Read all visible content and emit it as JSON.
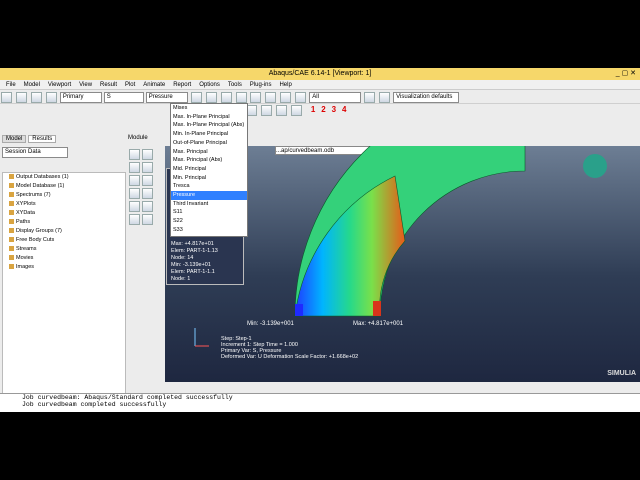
{
  "window": {
    "title": "Abaqus/CAE 6.14-1 [Viewport: 1]"
  },
  "menu": [
    "File",
    "Model",
    "Viewport",
    "View",
    "Result",
    "Plot",
    "Animate",
    "Report",
    "Options",
    "Tools",
    "Plug-ins",
    "Help"
  ],
  "toolbar": {
    "step_select": "Primary",
    "var_select": "S",
    "comp_select": "Pressure",
    "all_select": "All",
    "vis_defaults": "Visualization defaults",
    "frame_nums": [
      "1",
      "2",
      "3",
      "4"
    ]
  },
  "tabs": {
    "model": "Model",
    "results": "Results",
    "module": "Module",
    "visualize": "Visualiz"
  },
  "session_label": "Session Data",
  "tree": [
    "Output Databases (1)",
    "Model Database (1)",
    "Spectrums (7)",
    "XYPlots",
    "XYData",
    "Paths",
    "Display Groups (7)",
    "Free Body Cuts",
    "Streams",
    "Movies",
    "Images"
  ],
  "odb_path": "...ap/curvedbeam.odb",
  "dropdown": {
    "items": [
      "Mises",
      "Max. In-Plane Principal",
      "Max. In-Plane Principal (Abs)",
      "Min. In-Plane Principal",
      "Out-of-Plane Principal",
      "Max. Principal",
      "Max. Principal (Abs)",
      "Mid. Principal",
      "Min. Principal",
      "Tresca",
      "Pressure",
      "Third Invariant",
      "S11",
      "S22",
      "S33"
    ],
    "selected": "Pressure"
  },
  "legend": {
    "max_line": "Max: +4.817e+01",
    "max_elem": "Elem: PART-1-1.13",
    "max_node": "Node: 14",
    "min_line": "Min: -3.139e+01",
    "min_elem": "Elem: PART-1-1.1",
    "min_node": "Node: 1"
  },
  "labels": {
    "min_value": "Min: -3.139e+001",
    "max_value": "Max: +4.817e+001"
  },
  "status": {
    "step": "Step: Step-1",
    "increment": "Increment    1: Step Time =    1.000",
    "primary": "Primary Var: S, Pressure",
    "deformed": "Deformed Var: U   Deformation Scale Factor: +1.668e+02"
  },
  "brand": "SIMULIA",
  "messages": [
    "Job curvedbeam: Abaqus/Standard completed successfully",
    "Job curvedbeam completed successfully"
  ],
  "colors": {
    "title_bg": "#f6d76a",
    "selection": "#2f80ff",
    "accent_blue": "#1f3cff"
  }
}
